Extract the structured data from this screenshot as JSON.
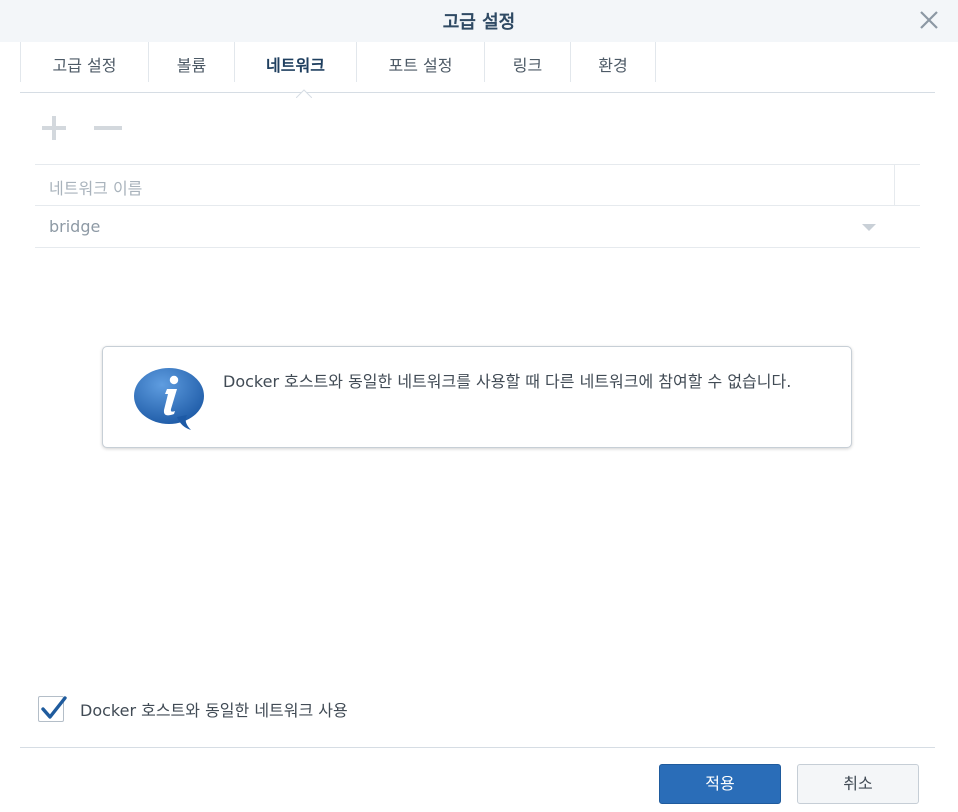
{
  "dialog": {
    "title": "고급 설정"
  },
  "tabs": [
    {
      "label": "고급 설정",
      "active": false
    },
    {
      "label": "볼륨",
      "active": false
    },
    {
      "label": "네트워크",
      "active": true
    },
    {
      "label": "포트 설정",
      "active": false
    },
    {
      "label": "링크",
      "active": false
    },
    {
      "label": "환경",
      "active": false
    }
  ],
  "toolbar": {
    "add_icon": "plus-icon",
    "remove_icon": "minus-icon"
  },
  "network_grid": {
    "column_header": "네트워크 이름",
    "rows": [
      {
        "name": "bridge"
      }
    ]
  },
  "info_message": {
    "icon": "info-icon",
    "text": "Docker 호스트와 동일한 네트워크를 사용할 때 다른 네트워크에 참여할 수 없습니다."
  },
  "host_network_checkbox": {
    "label": "Docker 호스트와 동일한 네트워크 사용",
    "checked": true
  },
  "buttons": {
    "apply": "적용",
    "cancel": "취소"
  },
  "colors": {
    "primary": "#2a6db8",
    "title": "#2f4a64",
    "disabled": "#d3d8dd"
  }
}
